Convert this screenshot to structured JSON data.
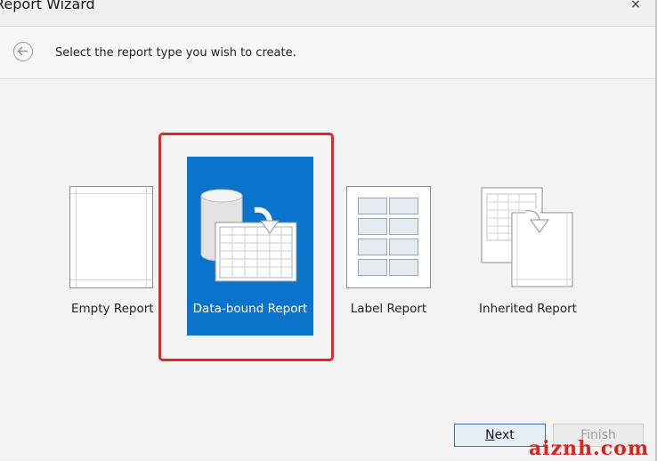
{
  "window": {
    "title": "Report Wizard",
    "close_glyph": "×"
  },
  "header": {
    "back_icon": "back-arrow-circle-icon",
    "instruction": "Select the report type you wish to create."
  },
  "report_types": [
    {
      "label": "Empty Report",
      "icon": "empty-page-icon",
      "selected": false
    },
    {
      "label": "Data-bound Report",
      "icon": "database-table-icon",
      "selected": true
    },
    {
      "label": "Label Report",
      "icon": "label-grid-icon",
      "selected": false
    },
    {
      "label": "Inherited Report",
      "icon": "inherited-pages-icon",
      "selected": false
    }
  ],
  "buttons": {
    "next_prefix": "",
    "next_mnemonic": "N",
    "next_rest": "ext",
    "finish": "Finish",
    "finish_enabled": false
  },
  "watermark": "aiznh.com",
  "colors": {
    "selected_tile": "#0a74cc",
    "highlight_border": "#e4242b",
    "watermark": "#d8231f"
  }
}
